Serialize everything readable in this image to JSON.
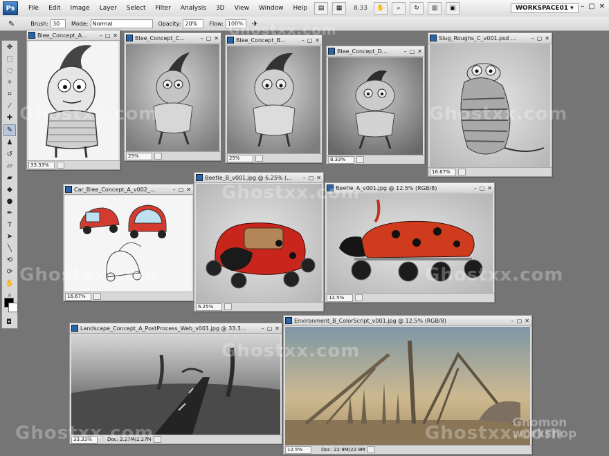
{
  "app": {
    "logo": "Ps",
    "zoom": "8.33",
    "workspace": "WORKSPACE01 ▾",
    "window_buttons": [
      "–",
      "▢",
      "✕"
    ]
  },
  "menu": [
    "File",
    "Edit",
    "Image",
    "Layer",
    "Select",
    "Filter",
    "Analysis",
    "3D",
    "View",
    "Window",
    "Help"
  ],
  "options": {
    "brush_label": "Brush:",
    "brush_size": "30",
    "mode_label": "Mode:",
    "mode_value": "Normal",
    "opacity_label": "Opacity:",
    "opacity_value": "20%",
    "flow_label": "Flow:",
    "flow_value": "100%"
  },
  "tools": [
    "move-icon",
    "marquee-icon",
    "lasso-icon",
    "quick-select-icon",
    "crop-icon",
    "eyedropper-icon",
    "healing-icon",
    "brush-icon",
    "stamp-icon",
    "history-brush-icon",
    "eraser-icon",
    "gradient-icon",
    "blur-icon",
    "dodge-icon",
    "pen-icon",
    "type-icon",
    "path-select-icon",
    "shape-icon",
    "3d-rotate-icon",
    "3d-orbit-icon",
    "hand-icon",
    "zoom-icon"
  ],
  "documents": [
    {
      "title": "Blee_Concept_A...",
      "zoom": "33.33%",
      "doc": ""
    },
    {
      "title": "Blee_Concept_C...",
      "zoom": "25%",
      "doc": ""
    },
    {
      "title": "Blee_Concept_B...",
      "zoom": "25%",
      "doc": ""
    },
    {
      "title": "Blee_Concept_D...",
      "zoom": "8.33%",
      "doc": ""
    },
    {
      "title": "Slug_Roughs_C_v001.psd ...",
      "zoom": "16.67%",
      "doc": ""
    },
    {
      "title": "Car_Blee_Concept_A_v002_...",
      "zoom": "16.67%",
      "doc": ""
    },
    {
      "title": "Beetle_B_v001.jpg @ 6.25% (...",
      "zoom": "6.25%",
      "doc": ""
    },
    {
      "title": "Beetle_A_v001.jpg @ 12.5% (RGB/8)",
      "zoom": "12.5%",
      "doc": ""
    },
    {
      "title": "Landscape_Concept_A_PostProcess_Web_v001.jpg @ 33.3...",
      "zoom": "33.33%",
      "doc": "Doc: 2.27M/2.27M"
    },
    {
      "title": "Environment_B_ColorScript_v001.jpg @ 12.5% (RGB/8)",
      "zoom": "12.5%",
      "doc": "Doc: 22.9M/22.9M"
    }
  ],
  "watermark": "Ghostxx.com",
  "corner_logo": "Gnomon workshop"
}
